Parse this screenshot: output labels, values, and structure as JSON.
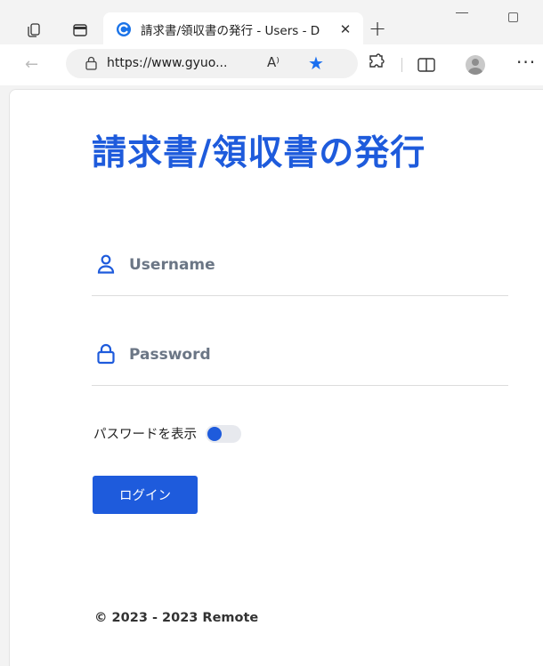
{
  "browser": {
    "tab": {
      "title": "請求書/領収書の発行 - Users - D",
      "close_glyph": "✕"
    },
    "new_tab_glyph": "+",
    "address": {
      "url": "https://www.gyuo...",
      "read_aloud_glyph": "A⁾"
    },
    "more_glyph": "···",
    "back_glyph": "←",
    "star_glyph": "★"
  },
  "page": {
    "heading": "請求書/領収書の発行",
    "username_placeholder": "Username",
    "password_placeholder": "Password",
    "show_password_label": "パスワードを表示",
    "show_password_on": false,
    "login_button": "ログイン",
    "footer": "© 2023 - 2023 Remote"
  },
  "colors": {
    "accent": "#1e5bdc",
    "favicon": "#1a73e8"
  }
}
